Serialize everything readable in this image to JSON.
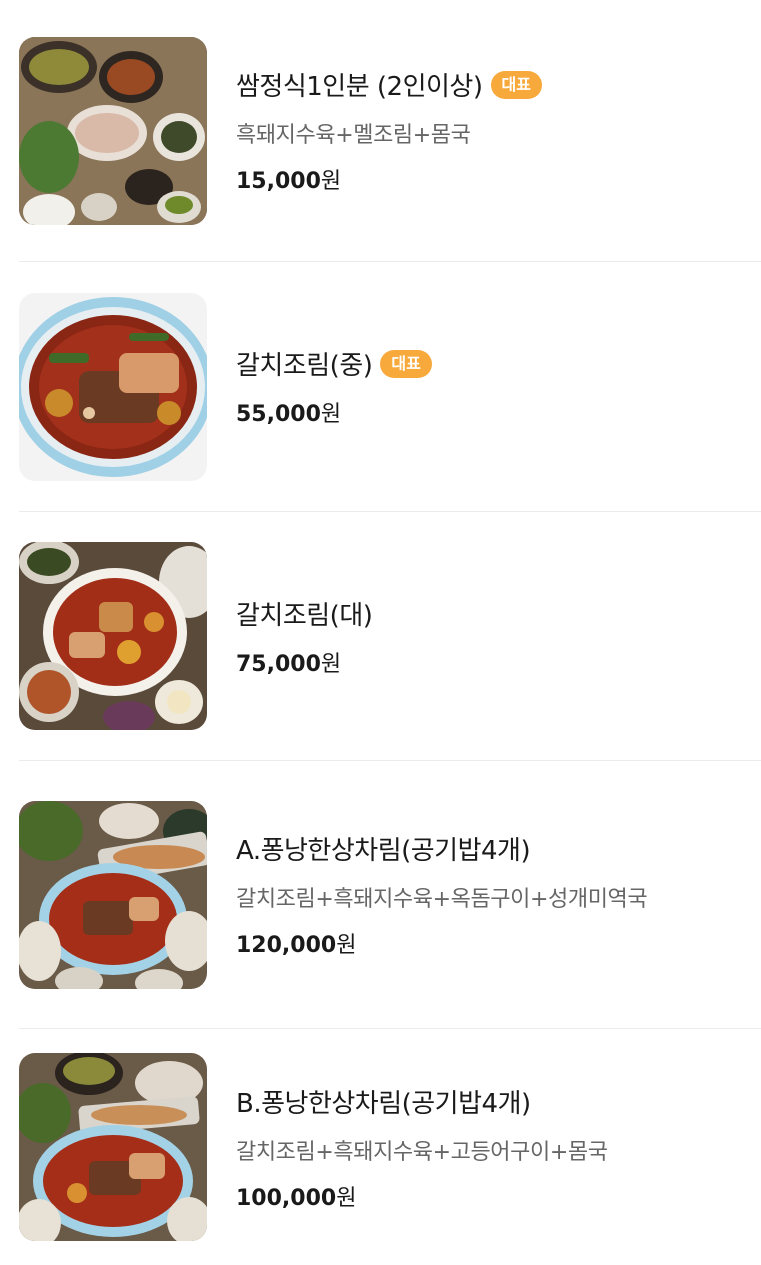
{
  "menu": {
    "items": [
      {
        "name": "쌈정식1인분 (2인이상)",
        "badge": "대표",
        "description": "흑돼지수육+멜조림+몸국",
        "price": "15,000",
        "currency": "원",
        "image_icon": "food-photo-icon"
      },
      {
        "name": "갈치조림(중)",
        "badge": "대표",
        "description": "",
        "price": "55,000",
        "currency": "원",
        "image_icon": "food-photo-icon"
      },
      {
        "name": "갈치조림(대)",
        "badge": "",
        "description": "",
        "price": "75,000",
        "currency": "원",
        "image_icon": "food-photo-icon"
      },
      {
        "name": "A.퐁낭한상차림(공기밥4개)",
        "badge": "",
        "description": "갈치조림+흑돼지수육+옥돔구이+성개미역국",
        "price": "120,000",
        "currency": "원",
        "image_icon": "food-photo-icon"
      },
      {
        "name": "B.퐁낭한상차림(공기밥4개)",
        "badge": "",
        "description": "갈치조림+흑돼지수육+고등어구이+몸국",
        "price": "100,000",
        "currency": "원",
        "image_icon": "food-photo-icon"
      }
    ]
  },
  "colors": {
    "badge_bg": "#f8a93b",
    "badge_text": "#ffffff",
    "divider": "#ececec",
    "description_text": "#666666"
  }
}
